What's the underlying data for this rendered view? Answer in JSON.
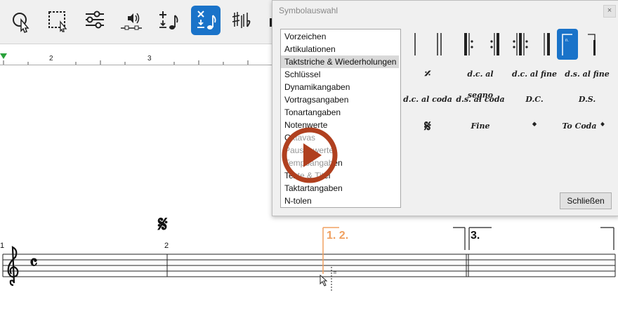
{
  "toolbar": {
    "buttons": [
      {
        "icon": "select-pointer-icon"
      },
      {
        "icon": "marquee-select-icon"
      },
      {
        "icon": "mixer-sliders-icon"
      },
      {
        "icon": "playback-speaker-icon"
      },
      {
        "icon": "note-input-icon"
      },
      {
        "icon": "note-input-active-icon"
      },
      {
        "icon": "accidentals-icon"
      }
    ]
  },
  "ruler": {
    "marks": [
      "2",
      "3"
    ]
  },
  "dialog": {
    "title": "Symbolauswahl",
    "close_glyph": "×",
    "categories": [
      "Vorzeichen",
      "Artikulationen",
      "Taktstriche & Wiederholungen",
      "Schlüssel",
      "Dynamikangaben",
      "Vortragsangaben",
      "Tonartangaben",
      "Notenwerte",
      "Oktavas",
      "Pausenwerte",
      "Tempoangaben",
      "Texte & Titel",
      "Taktartangaben",
      "N-tolen"
    ],
    "selected_category": "Taktstriche & Wiederholungen",
    "symbols": {
      "row2": [
        "d.c. al segno",
        "d.c. al fine",
        "d.s. al fine"
      ],
      "row3": [
        "d.c. al coda",
        "d.s. al coda",
        "D.C.",
        "D.S."
      ],
      "row4": [
        "Fine",
        "To Coda"
      ]
    },
    "close_button": "Schließen"
  },
  "score": {
    "measure_numbers": [
      "1",
      "2"
    ],
    "volta1": "1. 2.",
    "volta2": "3."
  },
  "colors": {
    "accent": "#1a73c9",
    "volta": "#f0a060",
    "play": "#b0401f"
  }
}
